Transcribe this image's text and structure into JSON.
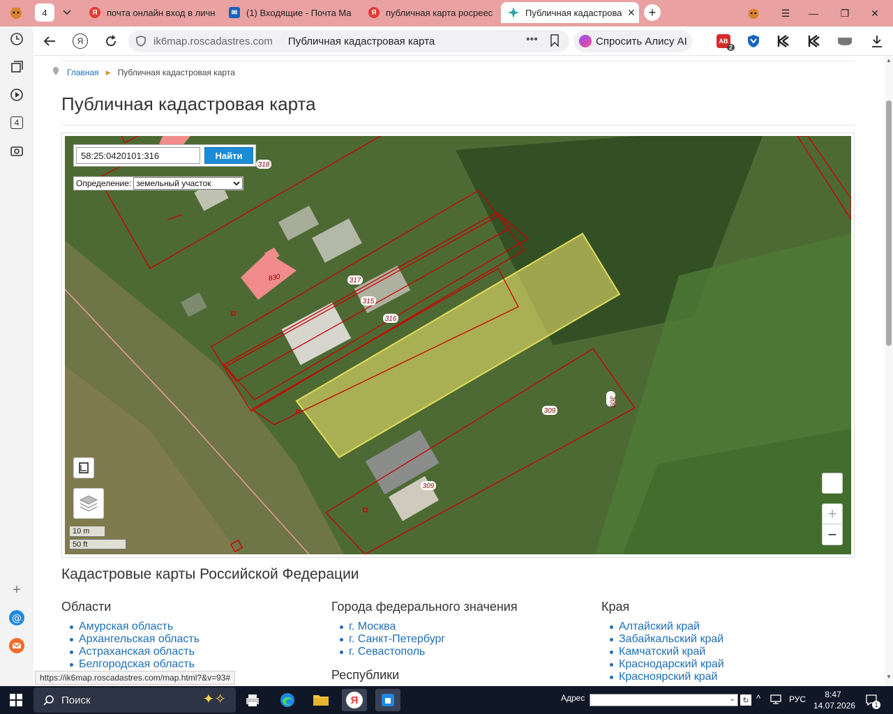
{
  "browser": {
    "tab_count": "4",
    "tabs": [
      {
        "title": "почта онлайн вход в личн",
        "favicon": "yandex-icon"
      },
      {
        "title": "(1) Входящие - Почта Ма",
        "favicon": "mail-icon"
      },
      {
        "title": "публичная карта росреес",
        "favicon": "yandex-icon"
      },
      {
        "title": "Публичная кадастрова",
        "favicon": "cadastre-icon",
        "active": true
      }
    ],
    "url_domain": "ik6map.roscadastres.com",
    "page_title": "Публичная кадастровая карта",
    "alice_label": "Спросить Алису AI",
    "ext_badge": "2",
    "sidebar_badge": "4"
  },
  "page": {
    "breadcrumb": {
      "home": "Главная",
      "current": "Публичная кадастровая карта"
    },
    "heading": "Публичная кадастровая карта",
    "map": {
      "search_value": "58:25:0420101:316",
      "search_button": "Найти",
      "definition_label": "Определение:",
      "definition_value": "земельный участок",
      "scale_m": "10 m",
      "scale_ft": "50 ft",
      "zoom_in": "+",
      "zoom_out": "−",
      "parcel_labels": {
        "p318": "318",
        "p830": "830",
        "p317": "317",
        "p315": "315",
        "p316": "316",
        "p309a": "309",
        "p309b": "309",
        "p309c": "309"
      },
      "colors": {
        "highlight": "#e8e06a",
        "boundary": "#cc0000",
        "building": "#f28b8b"
      }
    },
    "section_heading": "Кадастровые карты Российской Федерации",
    "columns": {
      "oblasti": {
        "title": "Области",
        "items": [
          "Амурская область",
          "Архангельская область",
          "Астраханская область",
          "Белгородская область"
        ]
      },
      "cities": {
        "title": "Города федерального значения",
        "items": [
          "г. Москва",
          "г. Санкт-Петербург",
          "г. Севастополь"
        ]
      },
      "respubliki": {
        "title": "Республики"
      },
      "kraya": {
        "title": "Края",
        "items": [
          "Алтайский край",
          "Забайкальский край",
          "Камчатский край",
          "Краснодарский край",
          "Красноярский край"
        ]
      }
    },
    "status_url": "https://ik6map.roscadastres.com/map.html?&v=93#"
  },
  "taskbar": {
    "search_label": "Поиск",
    "address_label": "Адрес",
    "lang": "РУС",
    "time": "8:47",
    "date": "14.07.2026",
    "notif_count": "1"
  }
}
